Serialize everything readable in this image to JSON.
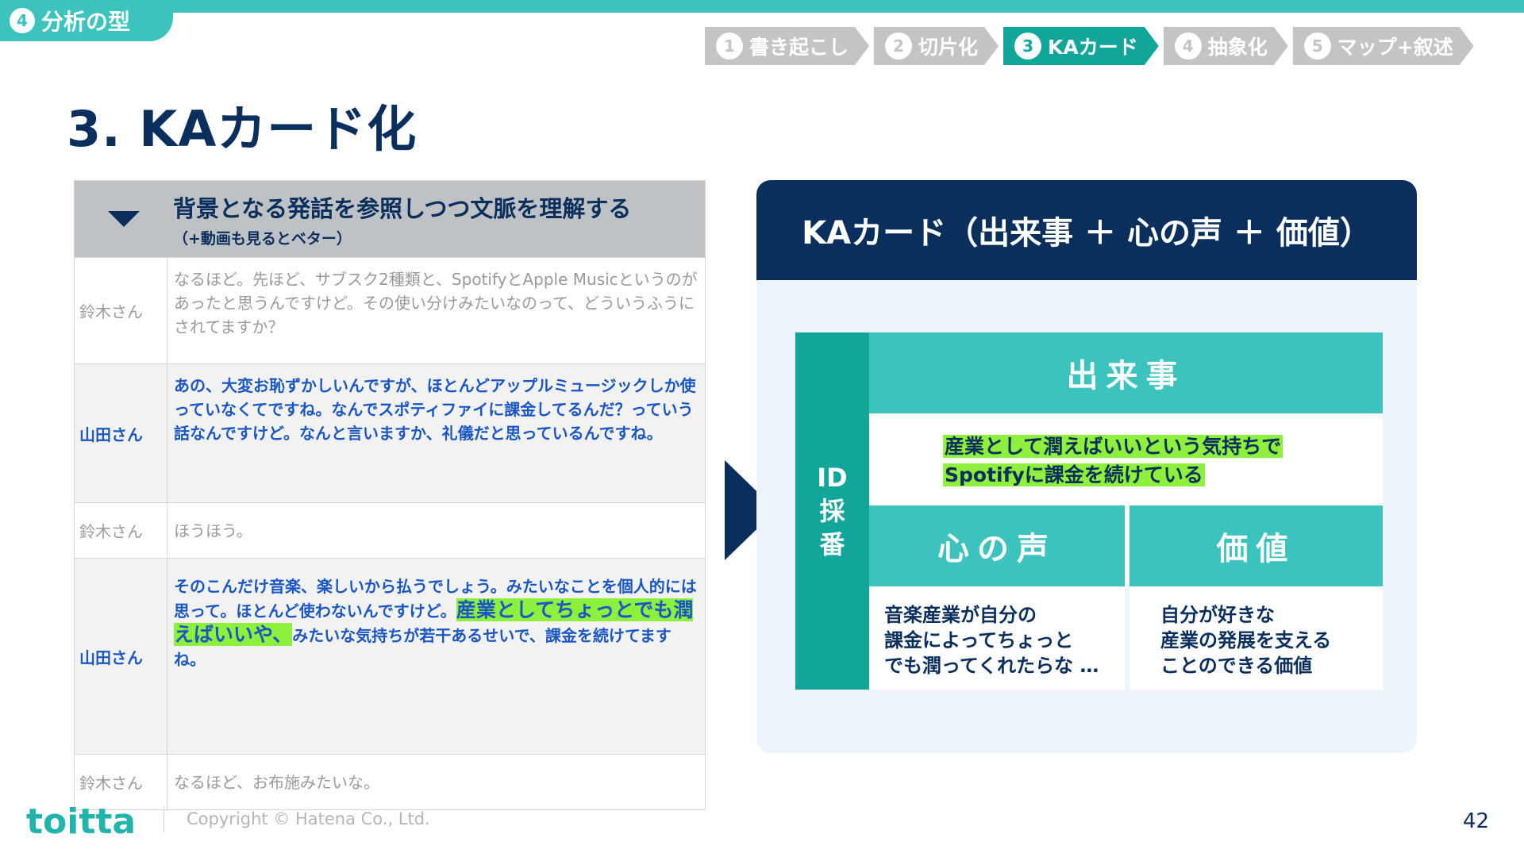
{
  "section": {
    "number": "4",
    "label": "分析の型"
  },
  "steps": [
    {
      "num": "1",
      "label": "書き起こし",
      "active": false
    },
    {
      "num": "2",
      "label": "切片化",
      "active": false
    },
    {
      "num": "3",
      "label": "KAカード",
      "active": true
    },
    {
      "num": "4",
      "label": "抽象化",
      "active": false
    },
    {
      "num": "5",
      "label": "マップ+叙述",
      "active": false
    }
  ],
  "title": "3. KAカード化",
  "transcript": {
    "heading": "背景となる発話を参照しつつ文脈を理解する",
    "subheading": "（+動画も見るとベター）",
    "rows": [
      {
        "speaker": "鈴木さん",
        "text": "なるほど。先ほど、サブスク2種類と、SpotifyとApple Musicというのがあったと思うんですけど。その使い分けみたいなのって、どういうふうにされてますか？"
      },
      {
        "speaker": "山田さん",
        "text": "あの、大変お恥ずかしいんですが、ほとんどアップルミュージックしか使っていなくてですね。なんでスポティファイに課金してるんだ？っていう話なんですけど。なんと言いますか、礼儀だと思っているんですね。"
      },
      {
        "speaker": "鈴木さん",
        "text": "ほうほう。"
      },
      {
        "speaker": "山田さん",
        "text_before": "そのこんだけ音楽、楽しいから払うでしょう。みたいなことを個人的には思って。ほとんど使わないんですけど。",
        "text_highlight": "産業としてちょっとでも潤えばいいや、",
        "text_after": "みたいな気持ちが若干あるせいで、課金を続けてますね。"
      },
      {
        "speaker": "鈴木さん",
        "text": "なるほど、お布施みたいな。"
      }
    ]
  },
  "ka_card": {
    "header": "KAカード（出来事 ＋ 心の声 ＋ 価値）",
    "id_label": [
      "ID",
      "採",
      "番"
    ],
    "event_label": "出来事",
    "event_lines": [
      "産業として潤えばいいという気持ちで",
      "Spotifyに課金を続けている"
    ],
    "voice_label": "心の声",
    "voice_text": "音楽産業が自分の\n課金によってちょっと\nでも潤ってくれたらな …",
    "value_label": "価値",
    "value_text": "自分が好きな\n産業の発展を支える\nことのできる価値"
  },
  "footer": {
    "logo": "toitta",
    "copyright": "Copyright © Hatena Co., Ltd.",
    "page": "42"
  }
}
